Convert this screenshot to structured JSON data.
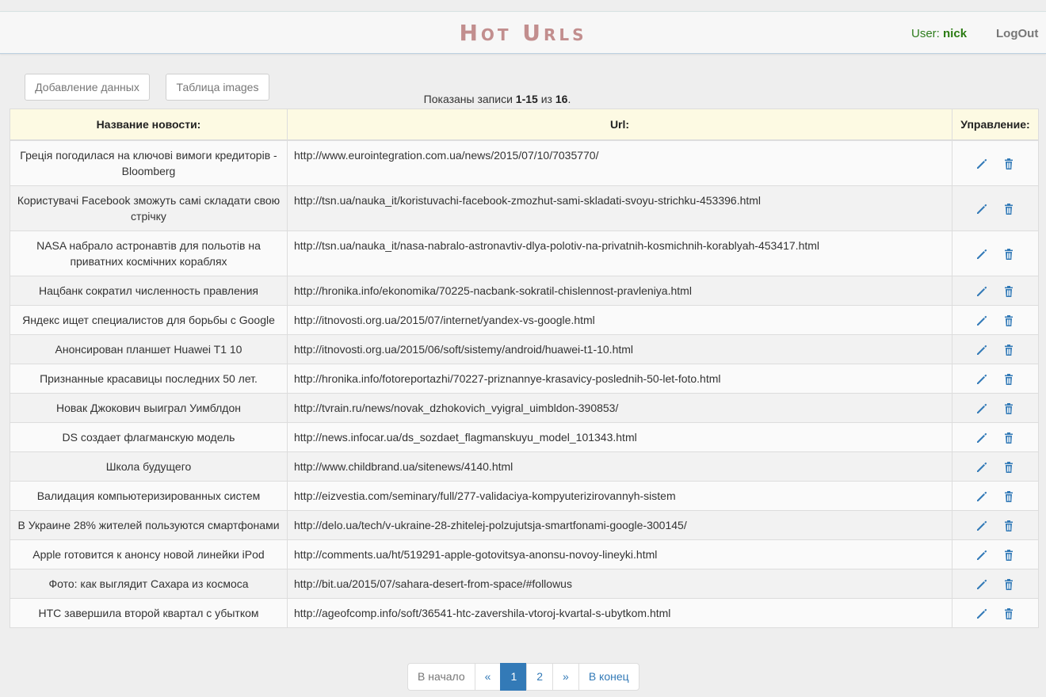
{
  "header": {
    "brand": "Hot Urls",
    "user_label": "User:",
    "user_name": "nick",
    "logout": "LogOut"
  },
  "toolbar": {
    "add_data": "Добавление данных",
    "images_table": "Таблица images"
  },
  "summary": {
    "prefix": "Показаны записи",
    "range": "1-15",
    "of": "из",
    "total": "16",
    "suffix": "."
  },
  "table": {
    "headers": [
      "Название новости:",
      "Url:",
      "Управление:"
    ],
    "rows": [
      {
        "title": "Греція погодилася на ключові вимоги кредиторів - Bloomberg",
        "url": "http://www.eurointegration.com.ua/news/2015/07/10/7035770/"
      },
      {
        "title": "Користувачі Facebook зможуть самі складати свою стрічку",
        "url": "http://tsn.ua/nauka_it/koristuvachi-facebook-zmozhut-sami-skladati-svoyu-strichku-453396.html"
      },
      {
        "title": "NASA набрало астронавтів для польотів на приватних космічних кораблях",
        "url": "http://tsn.ua/nauka_it/nasa-nabralo-astronavtiv-dlya-polotiv-na-privatnih-kosmichnih-korablyah-453417.html"
      },
      {
        "title": "Нацбанк сократил численность правления",
        "url": "http://hronika.info/ekonomika/70225-nacbank-sokratil-chislennost-pravleniya.html"
      },
      {
        "title": "Яндекс ищет специалистов для борьбы с Google",
        "url": "http://itnovosti.org.ua/2015/07/internet/yandex-vs-google.html"
      },
      {
        "title": "Анонсирован планшет Huawei T1 10",
        "url": "http://itnovosti.org.ua/2015/06/soft/sistemy/android/huawei-t1-10.html"
      },
      {
        "title": "Признанные красавицы последних 50 лет.",
        "url": "http://hronika.info/fotoreportazhi/70227-priznannye-krasavicy-poslednih-50-let-foto.html"
      },
      {
        "title": "Новак Джокович выиграл Уимблдон",
        "url": "http://tvrain.ru/news/novak_dzhokovich_vyigral_uimbldon-390853/"
      },
      {
        "title": "DS создает флагманскую модель",
        "url": "http://news.infocar.ua/ds_sozdaet_flagmanskuyu_model_101343.html"
      },
      {
        "title": "Школа будущего",
        "url": "http://www.childbrand.ua/sitenews/4140.html"
      },
      {
        "title": "Валидация компьютеризированных систем",
        "url": "http://eizvestia.com/seminary/full/277-validaciya-kompyuterizirovannyh-sistem"
      },
      {
        "title": "В Украине 28% жителей пользуются смартфонами",
        "url": "http://delo.ua/tech/v-ukraine-28-zhitelej-polzujutsja-smartfonami-google-300145/"
      },
      {
        "title": "Apple готовится к анонсу новой линейки iPod",
        "url": "http://comments.ua/ht/519291-apple-gotovitsya-anonsu-novoy-lineyki.html"
      },
      {
        "title": "Фото: как выглядит Сахара из космоса",
        "url": "http://bit.ua/2015/07/sahara-desert-from-space/#followus"
      },
      {
        "title": "HTC завершила второй квартал с убытком",
        "url": "http://ageofcomp.info/soft/36541-htc-zavershila-vtoroj-kvartal-s-ubytkom.html"
      }
    ]
  },
  "pagination": {
    "first": "В начало",
    "prev": "«",
    "pages": [
      "1",
      "2"
    ],
    "active_page": "1",
    "next": "»",
    "last": "В конец"
  },
  "icons": {
    "edit": "pencil-icon",
    "delete": "trash-icon"
  },
  "colors": {
    "brand": "#c28e8e",
    "user": "#2a7a12",
    "link": "#337ab7",
    "header_bg": "#fdfae3"
  }
}
